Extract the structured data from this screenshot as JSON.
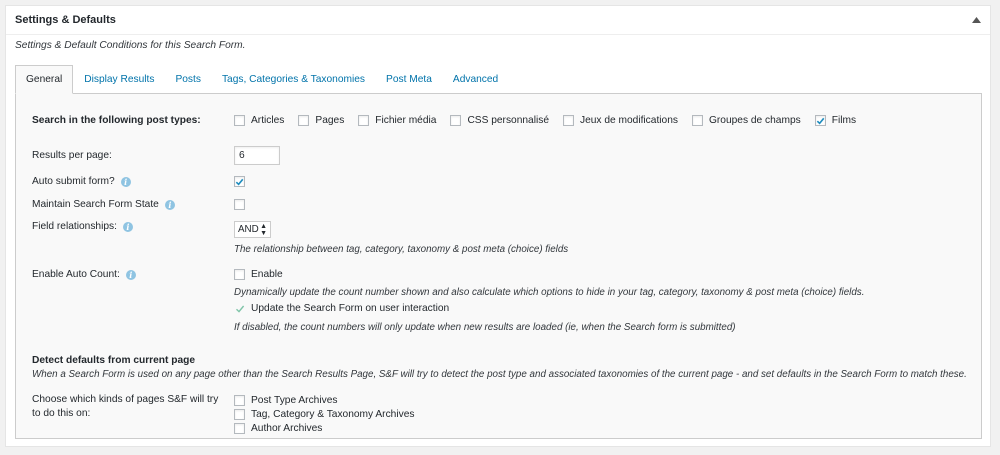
{
  "box": {
    "title": "Settings & Defaults",
    "description": "Settings & Default Conditions for this Search Form."
  },
  "tabs": [
    {
      "label": "General",
      "active": true
    },
    {
      "label": "Display Results"
    },
    {
      "label": "Posts"
    },
    {
      "label": "Tags, Categories & Taxonomies"
    },
    {
      "label": "Post Meta"
    },
    {
      "label": "Advanced"
    }
  ],
  "post_types": {
    "label": "Search in the following post types:",
    "options": [
      {
        "label": "Articles",
        "checked": false
      },
      {
        "label": "Pages",
        "checked": false
      },
      {
        "label": "Fichier média",
        "checked": false
      },
      {
        "label": "CSS personnalisé",
        "checked": false
      },
      {
        "label": "Jeux de modifications",
        "checked": false
      },
      {
        "label": "Groupes de champs",
        "checked": false
      },
      {
        "label": "Films",
        "checked": true
      }
    ]
  },
  "results_per_page": {
    "label": "Results per page:",
    "value": "6"
  },
  "auto_submit": {
    "label": "Auto submit form?",
    "checked": true
  },
  "maintain_state": {
    "label": "Maintain Search Form State",
    "checked": false
  },
  "field_relationships": {
    "label": "Field relationships:",
    "value": "AND",
    "help": "The relationship between tag, category, taxonomy & post meta (choice) fields"
  },
  "auto_count": {
    "label": "Enable Auto Count:",
    "enable_label": "Enable",
    "enable_checked": false,
    "help": "Dynamically update the count number shown and also calculate which options to hide in your tag, category, taxonomy & post meta (choice) fields.",
    "update_label": "Update the Search Form on user interaction",
    "update_checked": true,
    "update_help": "If disabled, the count numbers will only update when new results are loaded (ie, when the Search form is submitted)"
  },
  "detect": {
    "heading": "Detect defaults from current page",
    "description": "When a Search Form is used on any page other than the Search Results Page, S&F will try to detect the post type and associated taxonomies of the current page - and set defaults in the Search Form to match these.",
    "choose_label": "Choose which kinds of pages S&F will try to do this on:",
    "options": [
      {
        "label": "Post Type Archives",
        "checked": false
      },
      {
        "label": "Tag, Category & Taxonomy Archives",
        "checked": false
      },
      {
        "label": "Author Archives",
        "checked": false
      }
    ]
  },
  "colors": {
    "link": "#0073aa",
    "info_icon": "#8fc4e2",
    "check": "#1e8cbe"
  }
}
